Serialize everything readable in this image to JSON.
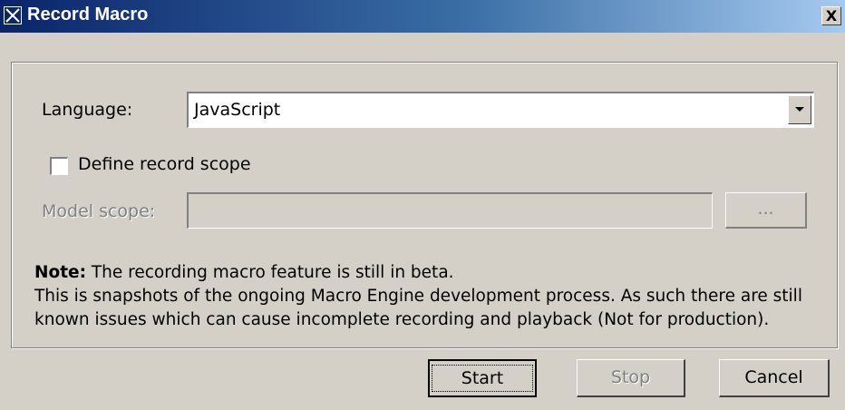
{
  "window": {
    "title": "Record Macro",
    "close_glyph": "X"
  },
  "form": {
    "language_label": "Language:",
    "language_value": "JavaScript",
    "define_scope_label": "Define record scope",
    "define_scope_checked": false,
    "model_scope_label": "Model scope:",
    "model_scope_value": "",
    "browse_label": "..."
  },
  "note": {
    "bold": "Note:",
    "line1": " The recording macro feature is still in beta.",
    "line2": "This is snapshots of the ongoing Macro Engine development process. As such there are still",
    "line3": "known issues which can cause incomplete recording and playback (Not for production)."
  },
  "buttons": {
    "start": "Start",
    "stop": "Stop",
    "cancel": "Cancel"
  },
  "icons": {
    "window": "macro-window-icon",
    "close": "close-icon",
    "dropdown": "chevron-down-icon"
  },
  "colors": {
    "title_start": "#0a246a",
    "title_end": "#a6caf0",
    "face": "#d4d0c8",
    "disabled_text": "#808080"
  }
}
